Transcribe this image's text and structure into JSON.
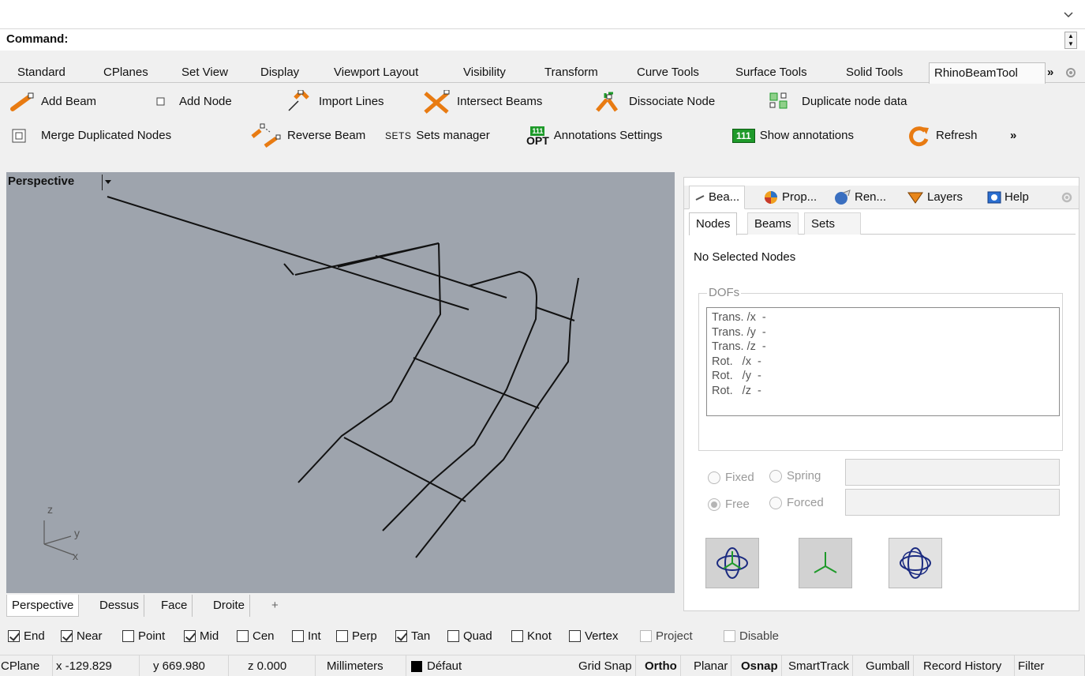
{
  "command": {
    "label": "Command:",
    "value": ""
  },
  "ribbon_tabs": [
    {
      "label": "Standard"
    },
    {
      "label": "CPlanes"
    },
    {
      "label": "Set View"
    },
    {
      "label": "Display"
    },
    {
      "label": "Viewport Layout"
    },
    {
      "label": "Visibility"
    },
    {
      "label": "Transform"
    },
    {
      "label": "Curve Tools"
    },
    {
      "label": "Surface Tools"
    },
    {
      "label": "Solid Tools"
    },
    {
      "label": "RhinoBeamTool",
      "active": true
    }
  ],
  "ribbon_more": "»",
  "toolbar": {
    "row1": {
      "add_beam": "Add Beam",
      "add_node": "Add Node",
      "import_lines": "Import Lines",
      "intersect_beams": "Intersect Beams",
      "dissociate_node": "Dissociate Node",
      "duplicate_node_data": "Duplicate node data"
    },
    "row2": {
      "merge_nodes": "Merge Duplicated Nodes",
      "reverse_beam": "Reverse Beam",
      "sets_icon_text": "SETS",
      "sets_manager": "Sets manager",
      "opt_badge_top": "111",
      "opt_badge_bottom": "OPT",
      "annotations_settings": "Annotations Settings",
      "show_badge": "111",
      "show_annotations": "Show annotations",
      "refresh": "Refresh",
      "more": "»"
    }
  },
  "viewport": {
    "title": "Perspective",
    "axis_labels": {
      "z": "z",
      "y": "y",
      "x": "x"
    },
    "tabs": [
      "Perspective",
      "Dessus",
      "Face",
      "Droite"
    ],
    "add_tab": "+"
  },
  "panel": {
    "tabs": [
      {
        "label": "Bea..."
      },
      {
        "label": "Prop..."
      },
      {
        "label": "Ren..."
      },
      {
        "label": "Layers"
      },
      {
        "label": "Help"
      }
    ],
    "subtabs": [
      "Nodes",
      "Beams",
      "Sets"
    ],
    "active_subtab": "Nodes",
    "no_selection": "No Selected Nodes",
    "dofs_legend": "DOFs",
    "dofs": [
      "Trans. /x  -",
      "Trans. /y  -",
      "Trans. /z  -",
      "Rot.   /x  -",
      "Rot.   /y  -",
      "Rot.   /z  -"
    ],
    "options": {
      "fixed": "Fixed",
      "spring": "Spring",
      "free": "Free",
      "forced": "Forced"
    },
    "selected_option": "Free"
  },
  "osnaps": [
    {
      "label": "End",
      "checked": true
    },
    {
      "label": "Near",
      "checked": true
    },
    {
      "label": "Point",
      "checked": false
    },
    {
      "label": "Mid",
      "checked": true
    },
    {
      "label": "Cen",
      "checked": false
    },
    {
      "label": "Int",
      "checked": false
    },
    {
      "label": "Perp",
      "checked": false
    },
    {
      "label": "Tan",
      "checked": true
    },
    {
      "label": "Quad",
      "checked": false
    },
    {
      "label": "Knot",
      "checked": false
    },
    {
      "label": "Vertex",
      "checked": false
    },
    {
      "label": "Project",
      "checked": false,
      "disabled": true
    },
    {
      "label": "Disable",
      "checked": false,
      "disabled": true
    }
  ],
  "status": {
    "cplane": "CPlane",
    "x": "x -129.829",
    "y": "y 669.980",
    "z": "z 0.000",
    "units": "Millimeters",
    "layer": "Défaut",
    "layer_color": "#000000",
    "grid_snap": "Grid Snap",
    "ortho": "Ortho",
    "planar": "Planar",
    "osnap": "Osnap",
    "smarttrack": "SmartTrack",
    "gumball": "Gumball",
    "record_history": "Record History",
    "filter": "Filter"
  },
  "colors": {
    "viewport_bg": "#9ea4ad",
    "accent_green": "#1e9a2a",
    "accent_orange": "#e87b12"
  }
}
